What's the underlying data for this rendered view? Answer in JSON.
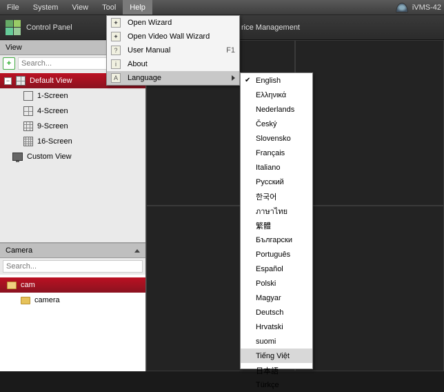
{
  "menubar": {
    "items": [
      "File",
      "System",
      "View",
      "Tool",
      "Help"
    ],
    "active": 4
  },
  "brand": "iVMS-42",
  "toolbar": {
    "control_panel": "Control Panel",
    "device_mgmt_suffix": "rice Management"
  },
  "view_panel": {
    "title": "View",
    "search_placeholder": "Search...",
    "default_view": "Default View",
    "screens": [
      "1-Screen",
      "4-Screen",
      "9-Screen",
      "16-Screen"
    ],
    "custom_view": "Custom View"
  },
  "camera_panel": {
    "title": "Camera",
    "search_placeholder": "Search...",
    "items": [
      "cam",
      "camera"
    ]
  },
  "help_menu": {
    "items": [
      {
        "label": "Open Wizard",
        "icon": "wizard"
      },
      {
        "label": "Open Video Wall Wizard",
        "icon": "wizard"
      },
      {
        "label": "User Manual",
        "icon": "help",
        "shortcut": "F1"
      },
      {
        "label": "About",
        "icon": "about"
      },
      {
        "label": "Language",
        "icon": "lang",
        "submenu": true
      }
    ]
  },
  "languages": [
    {
      "label": "English",
      "checked": true
    },
    {
      "label": "Ελληνικά"
    },
    {
      "label": "Nederlands"
    },
    {
      "label": "Český"
    },
    {
      "label": "Slovensko"
    },
    {
      "label": "Français"
    },
    {
      "label": "Italiano"
    },
    {
      "label": "Русский"
    },
    {
      "label": "한국어"
    },
    {
      "label": "ภาษาไทย"
    },
    {
      "label": "繁體"
    },
    {
      "label": "Български"
    },
    {
      "label": "Português"
    },
    {
      "label": "Español"
    },
    {
      "label": "Polski"
    },
    {
      "label": "Magyar"
    },
    {
      "label": "Deutsch"
    },
    {
      "label": "Hrvatski"
    },
    {
      "label": "suomi"
    },
    {
      "label": "Tiếng Việt",
      "hover": true
    },
    {
      "label": "日本語"
    },
    {
      "label": "Türkçe"
    }
  ]
}
